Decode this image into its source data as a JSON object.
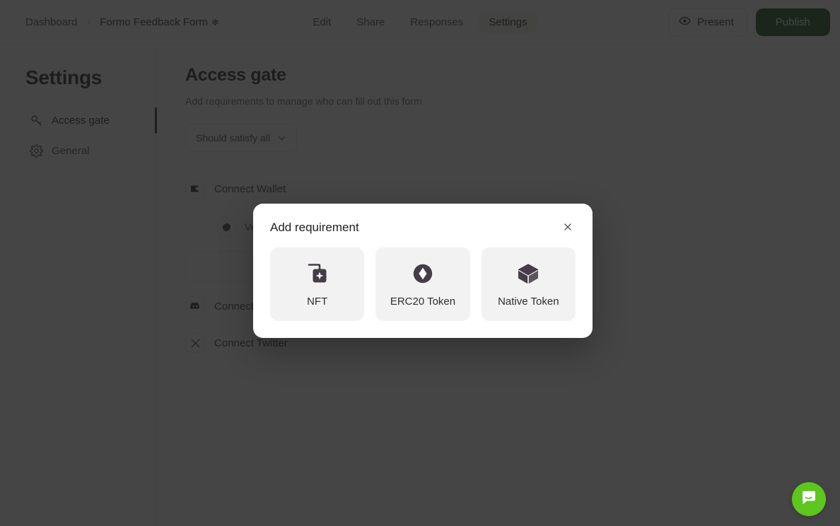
{
  "topbar": {
    "breadcrumb": {
      "dashboard": "Dashboard",
      "separator": "/",
      "current": "Formo Feedback Form",
      "emoji": "❄"
    },
    "tabs": [
      {
        "label": "Edit",
        "active": false
      },
      {
        "label": "Share",
        "active": false
      },
      {
        "label": "Responses",
        "active": false
      },
      {
        "label": "Settings",
        "active": true
      }
    ],
    "present_label": "Present",
    "publish_label": "Publish"
  },
  "sidebar": {
    "title": "Settings",
    "items": [
      {
        "label": "Access gate",
        "icon": "key-icon",
        "active": true
      },
      {
        "label": "General",
        "icon": "gear-icon",
        "active": false
      }
    ]
  },
  "main": {
    "title": "Access gate",
    "subtitle": "Add requirements to manage who can fill out this form",
    "satisfy_select": "Should satisfy all",
    "requirements": [
      {
        "label": "Connect Wallet",
        "icon": "wallet-icon",
        "enabled": true
      },
      {
        "label": "Connect Discord",
        "icon": "discord-icon",
        "enabled": false
      },
      {
        "label": "Connect Twitter",
        "icon": "twitter-x-icon",
        "enabled": false
      }
    ],
    "sub_requirement": {
      "label": "Ver",
      "icon": "verify-icon"
    }
  },
  "modal": {
    "title": "Add requirement",
    "close_label": "✕",
    "options": [
      {
        "label": "NFT",
        "icon": "nft-stack-icon"
      },
      {
        "label": "ERC20 Token",
        "icon": "erc20-token-icon"
      },
      {
        "label": "Native Token",
        "icon": "native-token-cube-icon"
      }
    ]
  },
  "chat": {
    "icon": "chat-bubble-icon"
  },
  "colors": {
    "publish_green": "#1d4d1d",
    "toggle_on_green": "#3ea033",
    "chat_green": "#5dc61f",
    "icon_dark": "#443d47",
    "overlay": "rgba(28,28,28,0.82)"
  }
}
